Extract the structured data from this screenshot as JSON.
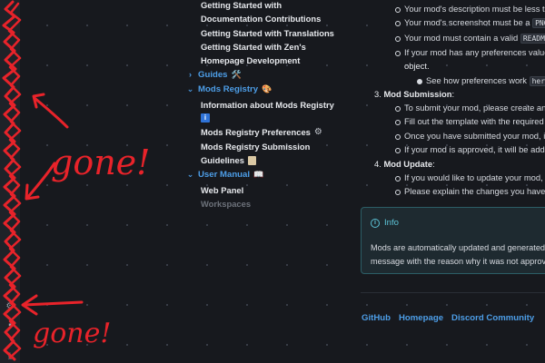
{
  "nav": {
    "links_top": [
      {
        "label": "Getting Started with"
      },
      {
        "label": "Documentation Contributions"
      },
      {
        "label": "Getting Started with Translations"
      },
      {
        "label": "Getting Started with Zen's"
      },
      {
        "label": "Homepage Development"
      }
    ],
    "guides": {
      "label": "Guides",
      "emoji": "🛠️"
    },
    "mods_registry": {
      "label": "Mods Registry",
      "emoji": "🎨"
    },
    "mods_items": [
      {
        "label": "Information about Mods Registry"
      },
      {
        "label": "Mods Registry Preferences"
      },
      {
        "label": "Mods Registry Submission"
      },
      {
        "label": "Guidelines"
      }
    ],
    "user_manual": {
      "label": "User Manual",
      "emoji": "📖"
    },
    "user_items": [
      {
        "label": "Web Panel"
      },
      {
        "label": "Workspaces"
      }
    ]
  },
  "content": {
    "bullets_top": [
      "Your mod's description must be less tha",
      "Your mod's screenshot must be a",
      "Your mod must contain a valid",
      "If your mod has any preferences values"
    ],
    "png_code": "PNG",
    "readme_code": "README",
    "object_text": "object.",
    "see_prefs_prefix": "See how preferences work",
    "see_prefs_link": "here.",
    "step3_num": "3.",
    "step3_title": "Mod Submission",
    "step3_bullets": [
      "To submit your mod, please create an is",
      "Fill out the template with the required i",
      "Once you have submitted your mod, it w",
      "If your mod is approved, it will be adde"
    ],
    "step4_num": "4.",
    "step4_title": "Mod Update",
    "step4_bullets": [
      "If you would like to update your mod, p",
      "Please explain the changes you have m"
    ]
  },
  "info": {
    "title": "Info",
    "line1": "Mods are automatically updated and generated b",
    "line2": "message with the reason why it was not approve"
  },
  "footer": {
    "links": [
      "GitHub",
      "Homepage",
      "Discord Community"
    ]
  },
  "annotation": {
    "text1": "gone!",
    "text2": "gone!"
  },
  "colors": {
    "accent": "#4d9ee8",
    "annotation": "#e8232a",
    "info": "#5cc3d6"
  }
}
